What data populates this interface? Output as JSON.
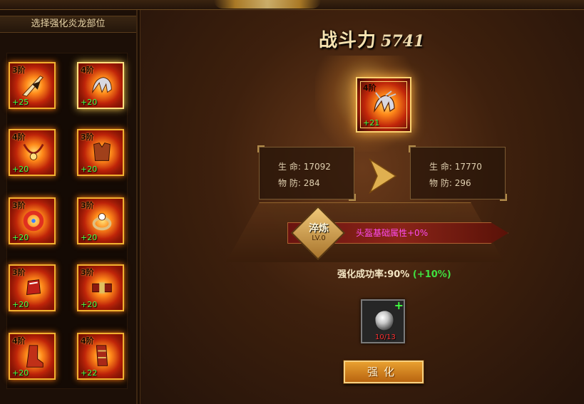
{
  "left_panel": {
    "title": "选择强化炎龙部位",
    "slots": [
      {
        "grade": "3阶",
        "plus": "+25",
        "icon": "sword-icon"
      },
      {
        "grade": "4阶",
        "plus": "+20",
        "icon": "helmet-icon"
      },
      {
        "grade": "4阶",
        "plus": "+20",
        "icon": "necklace-icon"
      },
      {
        "grade": "3阶",
        "plus": "+20",
        "icon": "armor-icon"
      },
      {
        "grade": "3阶",
        "plus": "+20",
        "icon": "bracelet-icon"
      },
      {
        "grade": "3阶",
        "plus": "+20",
        "icon": "ring-icon"
      },
      {
        "grade": "3阶",
        "plus": "+20",
        "icon": "gauntlet-icon"
      },
      {
        "grade": "3阶",
        "plus": "+20",
        "icon": "belt-icon"
      },
      {
        "grade": "4阶",
        "plus": "+20",
        "icon": "boots-icon"
      },
      {
        "grade": "4阶",
        "plus": "+22",
        "icon": "greaves-icon"
      }
    ]
  },
  "power": {
    "label": "战斗力",
    "value": "5741"
  },
  "selected_item": {
    "grade": "4阶",
    "plus": "+21",
    "icon": "helmet-icon"
  },
  "stats_before": {
    "hp_label": "生 命:",
    "hp_value": "17092",
    "def_label": "物 防:",
    "def_value": "284"
  },
  "stats_after": {
    "hp_label": "生 命:",
    "hp_value": "17770",
    "def_label": "物 防:",
    "def_value": "296"
  },
  "refine": {
    "badge": "淬炼",
    "level": "LV.0",
    "text": "头盔基础属性+0%"
  },
  "success_rate": {
    "label": "强化成功率:90%",
    "bonus": "(+10%)"
  },
  "material": {
    "count": "10/13",
    "add": "+",
    "icon": "stone-icon"
  },
  "button": {
    "label": "强化"
  },
  "colors": {
    "accent": "#f0b030",
    "green": "#46ff46",
    "magenta": "#ff4cf0",
    "red": "#ff3030"
  }
}
